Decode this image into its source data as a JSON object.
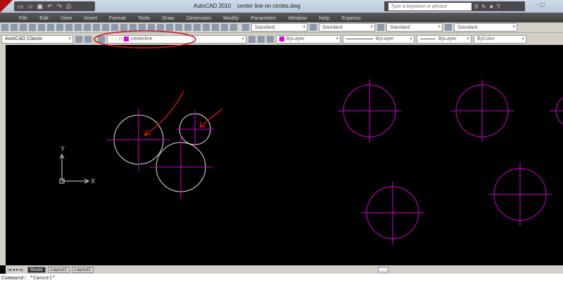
{
  "title": {
    "app": "AutoCAD 2010",
    "document": "center line on circles.dwg"
  },
  "search": {
    "placeholder": "Type a keyword or phrase"
  },
  "menu": [
    "File",
    "Edit",
    "View",
    "Insert",
    "Format",
    "Tools",
    "Draw",
    "Dimension",
    "Modify",
    "Parametric",
    "Window",
    "Help",
    "Express"
  ],
  "styles": {
    "text": "Standard",
    "dim": "Standard",
    "table": "Standard",
    "mleader": "Standard"
  },
  "workspace": "AutoCAD Classic",
  "layer": "centerline",
  "properties": {
    "color": "ByLayer",
    "linetype": "ByLayer",
    "lineweight": "ByLayer",
    "plotstyle": "ByColor"
  },
  "ucs": {
    "x": "X",
    "y": "Y"
  },
  "tabs": [
    "Model",
    "Layout1",
    "Layout2"
  ],
  "command": "Command: *Cancel*",
  "colors": {
    "centerline": "#d000d0",
    "circle": "#ffffff",
    "annotation": "#cc1010"
  }
}
